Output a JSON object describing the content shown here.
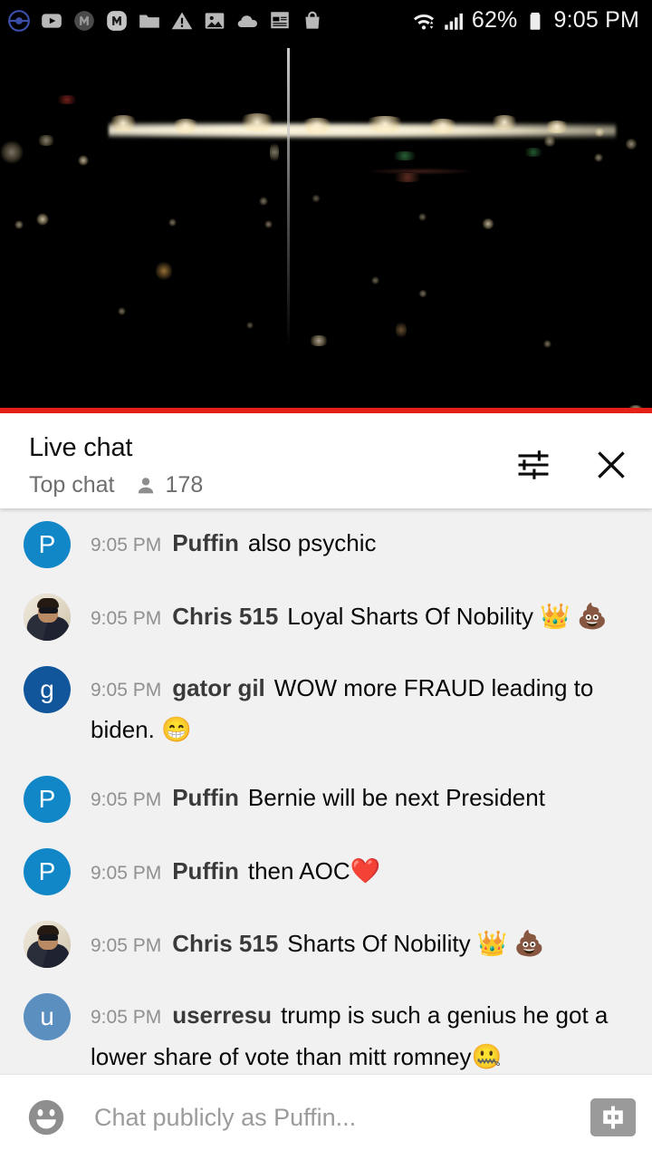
{
  "statusbar": {
    "icons": [
      {
        "name": "pokemon-go-icon"
      },
      {
        "name": "youtube-icon"
      },
      {
        "name": "m-app-dark-icon"
      },
      {
        "name": "m-app-light-icon"
      },
      {
        "name": "folder-icon"
      },
      {
        "name": "warning-icon"
      },
      {
        "name": "image-icon"
      },
      {
        "name": "cloud-icon"
      },
      {
        "name": "news-icon"
      },
      {
        "name": "shopping-bag-icon"
      }
    ],
    "wifi_icon": "wifi-icon",
    "signal_icon": "cellular-signal-icon",
    "battery_percent": "62%",
    "battery_icon": "battery-icon",
    "clock": "9:05 PM"
  },
  "player": {
    "progress_color": "#e62117",
    "progress_percent": 100,
    "scene": "night-cityscape"
  },
  "chat_header": {
    "title": "Live chat",
    "mode": "Top chat",
    "viewer_count": "178",
    "viewer_icon": "person-icon",
    "filter_icon": "tune-filter-icon",
    "close_icon": "close-icon"
  },
  "messages": [
    {
      "timestamp": "9:05 PM",
      "author": "Puffin",
      "text": "also psychic",
      "emoji": "",
      "avatar_type": "letter",
      "avatar_letter": "P",
      "avatar_color": "#1287c8"
    },
    {
      "timestamp": "9:05 PM",
      "author": "Chris 515",
      "text": "Loyal Sharts Of Nobility ",
      "emoji": "👑 💩",
      "avatar_type": "photo",
      "avatar_letter": "",
      "avatar_color": "#cfc7b8"
    },
    {
      "timestamp": "9:05 PM",
      "author": "gator gil",
      "text": "WOW more FRAUD leading to biden. ",
      "emoji": "😁",
      "avatar_type": "letter",
      "avatar_letter": "g",
      "avatar_color": "#11559b"
    },
    {
      "timestamp": "9:05 PM",
      "author": "Puffin",
      "text": "Bernie will be next President",
      "emoji": "",
      "avatar_type": "letter",
      "avatar_letter": "P",
      "avatar_color": "#1287c8"
    },
    {
      "timestamp": "9:05 PM",
      "author": "Puffin",
      "text": "then AOC",
      "emoji": "❤️",
      "avatar_type": "letter",
      "avatar_letter": "P",
      "avatar_color": "#1287c8"
    },
    {
      "timestamp": "9:05 PM",
      "author": "Chris 515",
      "text": "Sharts Of Nobility ",
      "emoji": "👑 💩",
      "avatar_type": "photo",
      "avatar_letter": "",
      "avatar_color": "#cfc7b8"
    },
    {
      "timestamp": "9:05 PM",
      "author": "userresu",
      "text": "trump is such a genius he got a lower share of vote than mitt romney",
      "emoji": "🤐",
      "avatar_type": "letter",
      "avatar_letter": "u",
      "avatar_color": "#5b8fc0"
    }
  ],
  "input_bar": {
    "emoji_icon": "emoji-smiley-icon",
    "placeholder": "Chat publicly as Puffin...",
    "superchat_icon": "super-chat-dollar-icon"
  }
}
